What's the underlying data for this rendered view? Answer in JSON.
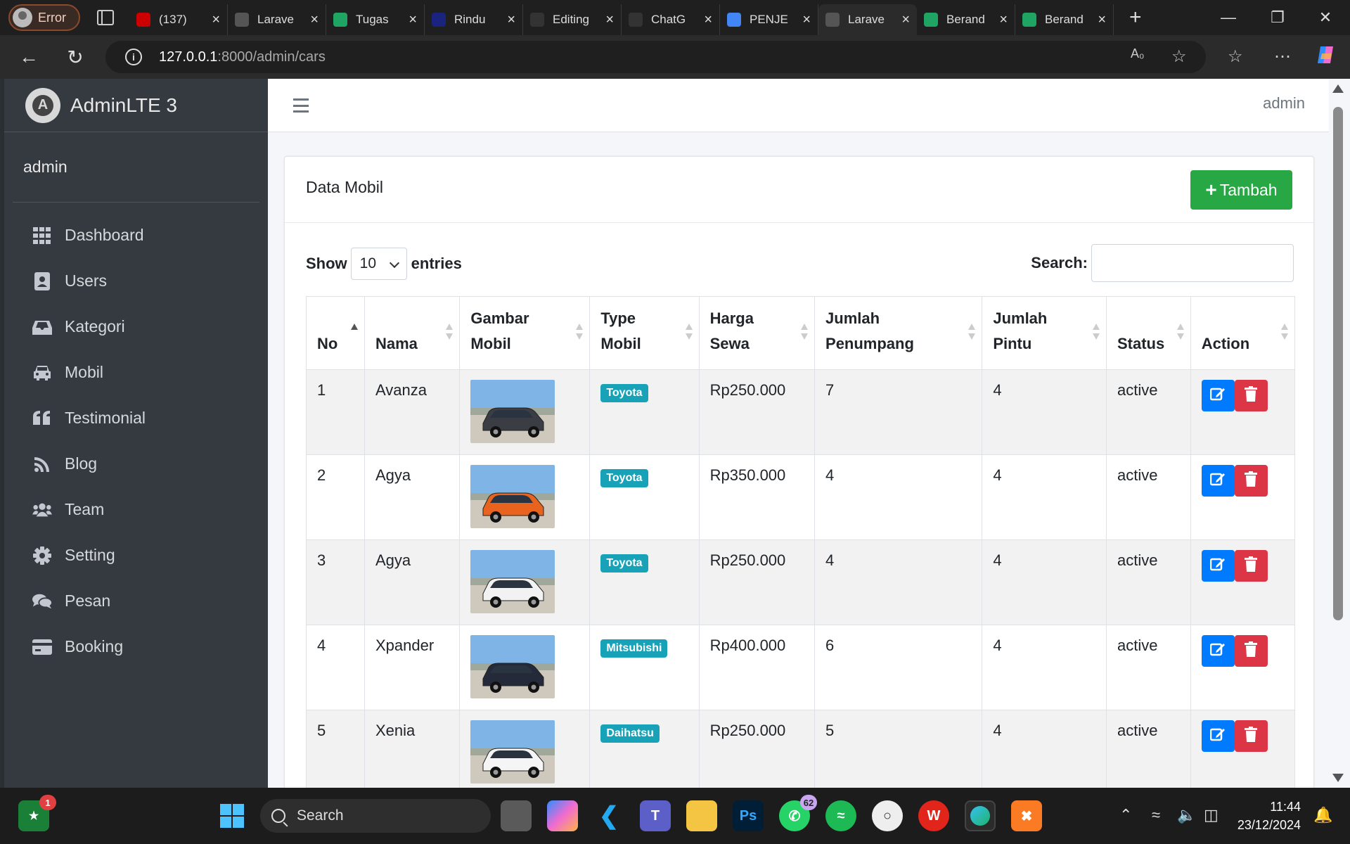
{
  "browser": {
    "profile_label": "Error",
    "tabs": [
      {
        "label": "(137)",
        "icon": "youtube-icon",
        "color": "#cc0000"
      },
      {
        "label": "Larave",
        "icon": "globe-icon",
        "color": "#555555"
      },
      {
        "label": "Tugas",
        "icon": "drive-icon",
        "color": "#1fa463"
      },
      {
        "label": "Rindu",
        "icon": "app-icon",
        "color": "#1a237e"
      },
      {
        "label": "Editing",
        "icon": "github-icon",
        "color": "#333333"
      },
      {
        "label": "ChatG",
        "icon": "chatgpt-icon",
        "color": "#333333"
      },
      {
        "label": "PENJE",
        "icon": "docs-icon",
        "color": "#4285f4"
      },
      {
        "label": "Larave",
        "icon": "globe-icon",
        "color": "#555555",
        "active": true
      },
      {
        "label": "Berand",
        "icon": "drive-icon",
        "color": "#1fa463"
      },
      {
        "label": "Berand",
        "icon": "drive-icon",
        "color": "#1fa463"
      }
    ],
    "url_host": "127.0.0.1",
    "url_rest": ":8000/admin/cars"
  },
  "sidebar": {
    "brand": "AdminLTE 3",
    "user": "admin",
    "items": [
      {
        "label": "Dashboard",
        "icon": "dashboard-grid-icon"
      },
      {
        "label": "Users",
        "icon": "user-card-icon"
      },
      {
        "label": "Kategori",
        "icon": "inbox-icon"
      },
      {
        "label": "Mobil",
        "icon": "car-icon"
      },
      {
        "label": "Testimonial",
        "icon": "quote-icon"
      },
      {
        "label": "Blog",
        "icon": "rss-icon"
      },
      {
        "label": "Team",
        "icon": "users-icon"
      },
      {
        "label": "Setting",
        "icon": "gear-icon"
      },
      {
        "label": "Pesan",
        "icon": "comments-icon"
      },
      {
        "label": "Booking",
        "icon": "credit-card-icon"
      }
    ]
  },
  "topnav": {
    "user": "admin"
  },
  "card": {
    "title": "Data Mobil",
    "add_button": "Tambah",
    "show_label": "Show",
    "entries_value": "10",
    "entries_label": "entries",
    "search_label": "Search:"
  },
  "table": {
    "headers": [
      [
        "No"
      ],
      [
        "Nama"
      ],
      [
        "Gambar",
        "Mobil"
      ],
      [
        "Type",
        "Mobil"
      ],
      [
        "Harga",
        "Sewa"
      ],
      [
        "Jumlah",
        "Penumpang"
      ],
      [
        "Jumlah",
        "Pintu"
      ],
      [
        "Status"
      ],
      [
        "Action"
      ]
    ],
    "rows": [
      {
        "no": "1",
        "nama": "Avanza",
        "type": "Toyota",
        "harga": "Rp250.000",
        "penumpang": "7",
        "pintu": "4",
        "status": "active",
        "car_color": "#3a3d44"
      },
      {
        "no": "2",
        "nama": "Agya",
        "type": "Toyota",
        "harga": "Rp350.000",
        "penumpang": "4",
        "pintu": "4",
        "status": "active",
        "car_color": "#e8641e"
      },
      {
        "no": "3",
        "nama": "Agya",
        "type": "Toyota",
        "harga": "Rp250.000",
        "penumpang": "4",
        "pintu": "4",
        "status": "active",
        "car_color": "#f2f2f2"
      },
      {
        "no": "4",
        "nama": "Xpander",
        "type": "Mitsubishi",
        "harga": "Rp400.000",
        "penumpang": "6",
        "pintu": "4",
        "status": "active",
        "car_color": "#252a3a"
      },
      {
        "no": "5",
        "nama": "Xenia",
        "type": "Daihatsu",
        "harga": "Rp250.000",
        "penumpang": "5",
        "pintu": "4",
        "status": "active",
        "car_color": "#f5f5f5"
      }
    ]
  },
  "taskbar": {
    "search_label": "Search",
    "whatsapp_badge": "62",
    "store_badge": "1",
    "time": "11:44",
    "date": "23/12/2024"
  }
}
